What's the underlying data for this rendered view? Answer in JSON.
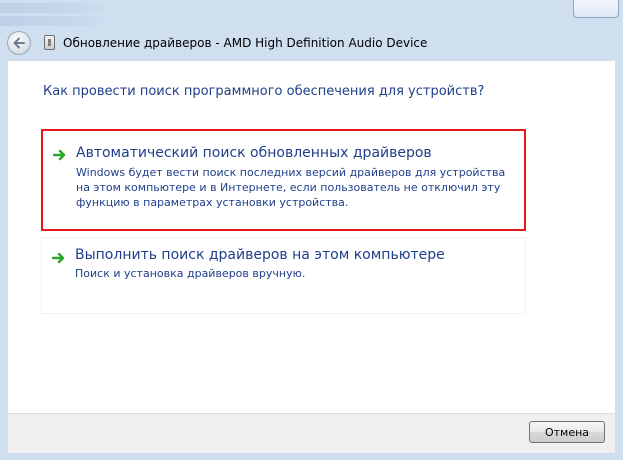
{
  "window": {
    "title": "Обновление драйверов - AMD High Definition Audio Device"
  },
  "main": {
    "question": "Как провести поиск программного обеспечения для устройств?",
    "options": [
      {
        "title": "Автоматический поиск обновленных драйверов",
        "description": "Windows будет вести поиск последних версий драйверов для устройства на этом компьютере и в Интернете, если пользователь не отключил эту функцию в параметрах установки устройства.",
        "icon": "green-arrow-icon",
        "highlighted": true,
        "highlight_color": "#e3161b"
      },
      {
        "title": "Выполнить поиск драйверов на этом компьютере",
        "description": "Поиск и установка драйверов вручную.",
        "icon": "green-arrow-icon",
        "highlighted": false
      }
    ]
  },
  "footer": {
    "cancel_label": "Отмена"
  },
  "colors": {
    "link_text": "#1f3f8a",
    "frame": "#cfdff0",
    "arrow": "#2aa52a"
  }
}
